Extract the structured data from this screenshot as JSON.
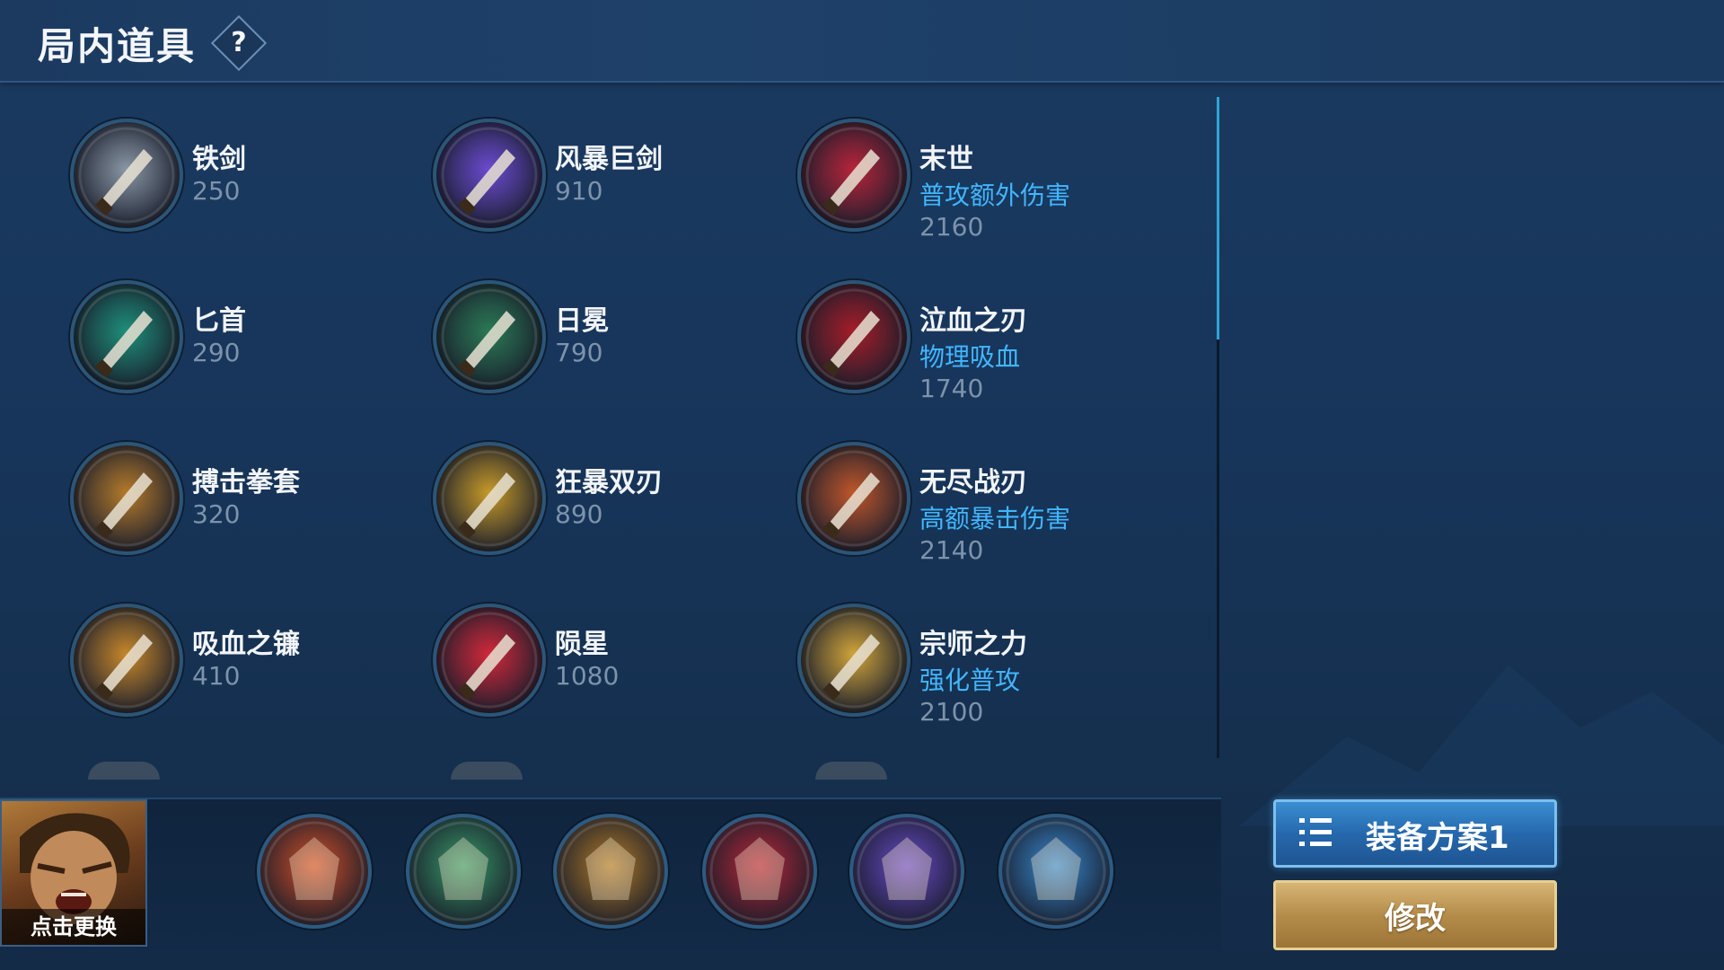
{
  "header": {
    "title": "局内道具",
    "help_label": "?"
  },
  "items": [
    {
      "name": "铁剑",
      "price": "250",
      "effect": "",
      "icon": "iron-sword-icon",
      "color": "#8a97a6"
    },
    {
      "name": "风暴巨剑",
      "price": "910",
      "effect": "",
      "icon": "storm-sword-icon",
      "color": "#6b4bd1"
    },
    {
      "name": "末世",
      "price": "2160",
      "effect": "普攻额外伤害",
      "icon": "doomsday-icon",
      "color": "#b8243a"
    },
    {
      "name": "匕首",
      "price": "290",
      "effect": "",
      "icon": "dagger-icon",
      "color": "#1e8f7a"
    },
    {
      "name": "日冕",
      "price": "790",
      "effect": "",
      "icon": "corona-icon",
      "color": "#2a7a55"
    },
    {
      "name": "泣血之刃",
      "price": "1740",
      "effect": "物理吸血",
      "icon": "bloodweep-blade-icon",
      "color": "#a61c28"
    },
    {
      "name": "搏击拳套",
      "price": "320",
      "effect": "",
      "icon": "boxing-gauntlet-icon",
      "color": "#b57a2a"
    },
    {
      "name": "狂暴双刃",
      "price": "890",
      "effect": "",
      "icon": "berserk-blades-icon",
      "color": "#c79a28"
    },
    {
      "name": "无尽战刃",
      "price": "2140",
      "effect": "高额暴击伤害",
      "icon": "infinity-blade-icon",
      "color": "#c0562a"
    },
    {
      "name": "吸血之镰",
      "price": "410",
      "effect": "",
      "icon": "vampire-scythe-icon",
      "color": "#c8882a"
    },
    {
      "name": "陨星",
      "price": "1080",
      "effect": "",
      "icon": "meteor-icon",
      "color": "#d2283a"
    },
    {
      "name": "宗师之力",
      "price": "2100",
      "effect": "强化普攻",
      "icon": "master-power-icon",
      "color": "#d2a53a"
    }
  ],
  "hero": {
    "change_label": "点击更换"
  },
  "equipped_slots": [
    {
      "icon": "fire-emblem-icon",
      "color": "#d2502a"
    },
    {
      "icon": "boots-icon",
      "color": "#3a9a6a"
    },
    {
      "icon": "armor-icon",
      "color": "#b07a2a"
    },
    {
      "icon": "blood-armor-icon",
      "color": "#b8283a"
    },
    {
      "icon": "purple-cloak-icon",
      "color": "#6a4ac8"
    },
    {
      "icon": "blue-gem-shield-icon",
      "color": "#3a8ad2"
    }
  ],
  "actions": {
    "plan_label": "装备方案1",
    "modify_label": "修改"
  },
  "colors": {
    "effect_text": "#41b6ff",
    "price_text": "#7d93ab",
    "scroll_thumb": "#2fa4d8"
  }
}
